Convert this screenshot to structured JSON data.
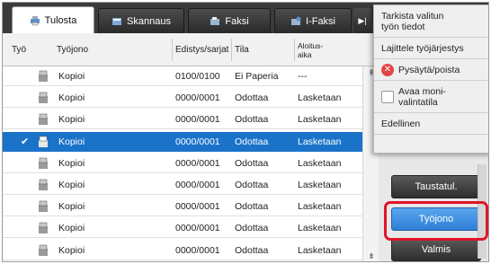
{
  "tabs": [
    {
      "label": "Tulosta",
      "icon": "print-icon"
    },
    {
      "label": "Skannaus",
      "icon": "scan-icon"
    },
    {
      "label": "Faksi",
      "icon": "fax-icon"
    },
    {
      "label": "I-Faksi",
      "icon": "internet-fax-icon"
    }
  ],
  "tab_scroll": "▶|",
  "columns": {
    "type": "Työ",
    "job": "Työjono",
    "sets": "Edistys/sarjat",
    "status": "Tila",
    "start_line1": "Aloitus-",
    "start_line2": "aika"
  },
  "rows": [
    {
      "name": "Kopioi",
      "sets": "0100/0100",
      "status": "Ei Paperia",
      "start": "---",
      "selected": false
    },
    {
      "name": "Kopioi",
      "sets": "0000/0001",
      "status": "Odottaa",
      "start": "Lasketaan",
      "selected": false
    },
    {
      "name": "Kopioi",
      "sets": "0000/0001",
      "status": "Odottaa",
      "start": "Lasketaan",
      "selected": false
    },
    {
      "name": "Kopioi",
      "sets": "0000/0001",
      "status": "Odottaa",
      "start": "Lasketaan",
      "selected": true
    },
    {
      "name": "Kopioi",
      "sets": "0000/0001",
      "status": "Odottaa",
      "start": "Lasketaan",
      "selected": false
    },
    {
      "name": "Kopioi",
      "sets": "0000/0001",
      "status": "Odottaa",
      "start": "Lasketaan",
      "selected": false
    },
    {
      "name": "Kopioi",
      "sets": "0000/0001",
      "status": "Odottaa",
      "start": "Lasketaan",
      "selected": false
    },
    {
      "name": "Kopioi",
      "sets": "0000/0001",
      "status": "Odottaa",
      "start": "Lasketaan",
      "selected": false
    },
    {
      "name": "Kopioi",
      "sets": "0000/0001",
      "status": "Odottaa",
      "start": "Lasketaan",
      "selected": false
    }
  ],
  "selected_check": "✔",
  "menu": {
    "item1_line1": "Tarkista valitun",
    "item1_line2": "työn tiedot",
    "item2": "Lajittele työjärjestys",
    "item3": "Pysäytä/poista",
    "item4_line1": "Avaa moni-",
    "item4_line2": "valintatila",
    "item5": "Edellinen"
  },
  "buttons": {
    "taustatul": "Taustatul.",
    "tyojono": "Työjono",
    "valmis": "Valmis"
  },
  "colors": {
    "selected_row": "#1a73c9",
    "highlight": "#e0152a",
    "tyojono_button": "#3a8ce0"
  }
}
